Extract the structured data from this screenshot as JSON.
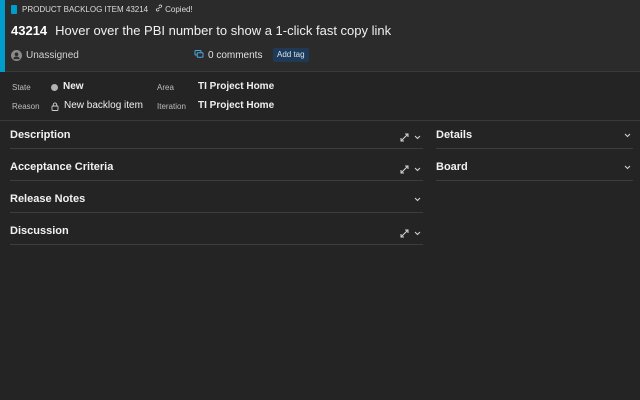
{
  "header": {
    "type_label": "PRODUCT BACKLOG ITEM 43214",
    "copied_label": "Copied!",
    "item_id": "43214",
    "item_title": "Hover over the PBI number to show a 1-click fast copy link",
    "assignee": "Unassigned",
    "comments": "0 comments",
    "add_tag": "Add tag",
    "accent_color": "#009ccc"
  },
  "fields": {
    "state_label": "State",
    "state_value": "New",
    "reason_label": "Reason",
    "reason_value": "New backlog item",
    "area_label": "Area",
    "area_value": "TI Project Home",
    "iteration_label": "Iteration",
    "iteration_value": "TI Project Home"
  },
  "sections_left": [
    {
      "title": "Description"
    },
    {
      "title": "Acceptance Criteria"
    },
    {
      "title": "Release Notes"
    },
    {
      "title": "Discussion"
    }
  ],
  "sections_right": [
    {
      "title": "Details"
    },
    {
      "title": "Board"
    }
  ],
  "icons": {
    "work_item_type": "backlog-item-icon",
    "copy": "link-icon",
    "avatar": "person-icon",
    "comments": "comment-icon",
    "expand": "expand-diagonal-icon",
    "collapse": "chevron-down-icon",
    "reason": "lock-icon"
  }
}
